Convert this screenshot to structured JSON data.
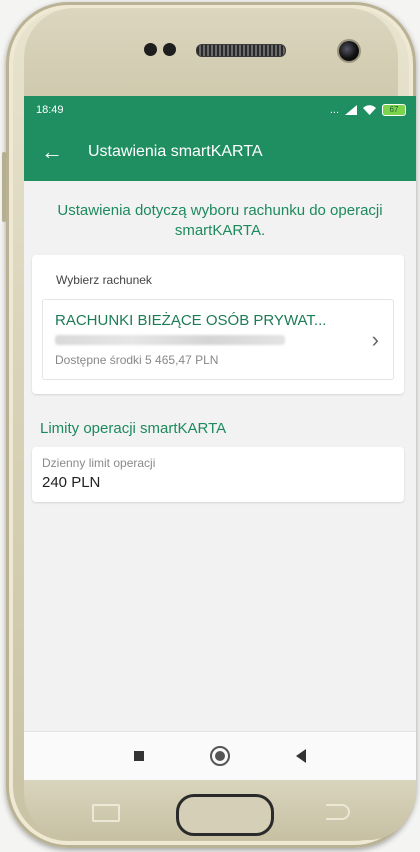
{
  "status_bar": {
    "time": "18:49",
    "signal_text": "...",
    "battery": "67"
  },
  "app_bar": {
    "back_icon": "←",
    "title": "Ustawienia smartKARTA"
  },
  "info_text": "Ustawienia dotyczą wyboru rachunku do operacji smartKARTA.",
  "account_section": {
    "label": "Wybierz rachunek",
    "account_name": "RACHUNKI BIEŻĄCE OSÓB PRYWAT...",
    "available_funds": "Dostępne środki 5 465,47 PLN",
    "chevron": "›"
  },
  "limits": {
    "heading": "Limity operacji smartKARTA",
    "daily_label": "Dzienny limit operacji",
    "daily_value": "240 PLN"
  },
  "colors": {
    "brand_green": "#1f8f62",
    "text_green": "#1d8a5e"
  }
}
